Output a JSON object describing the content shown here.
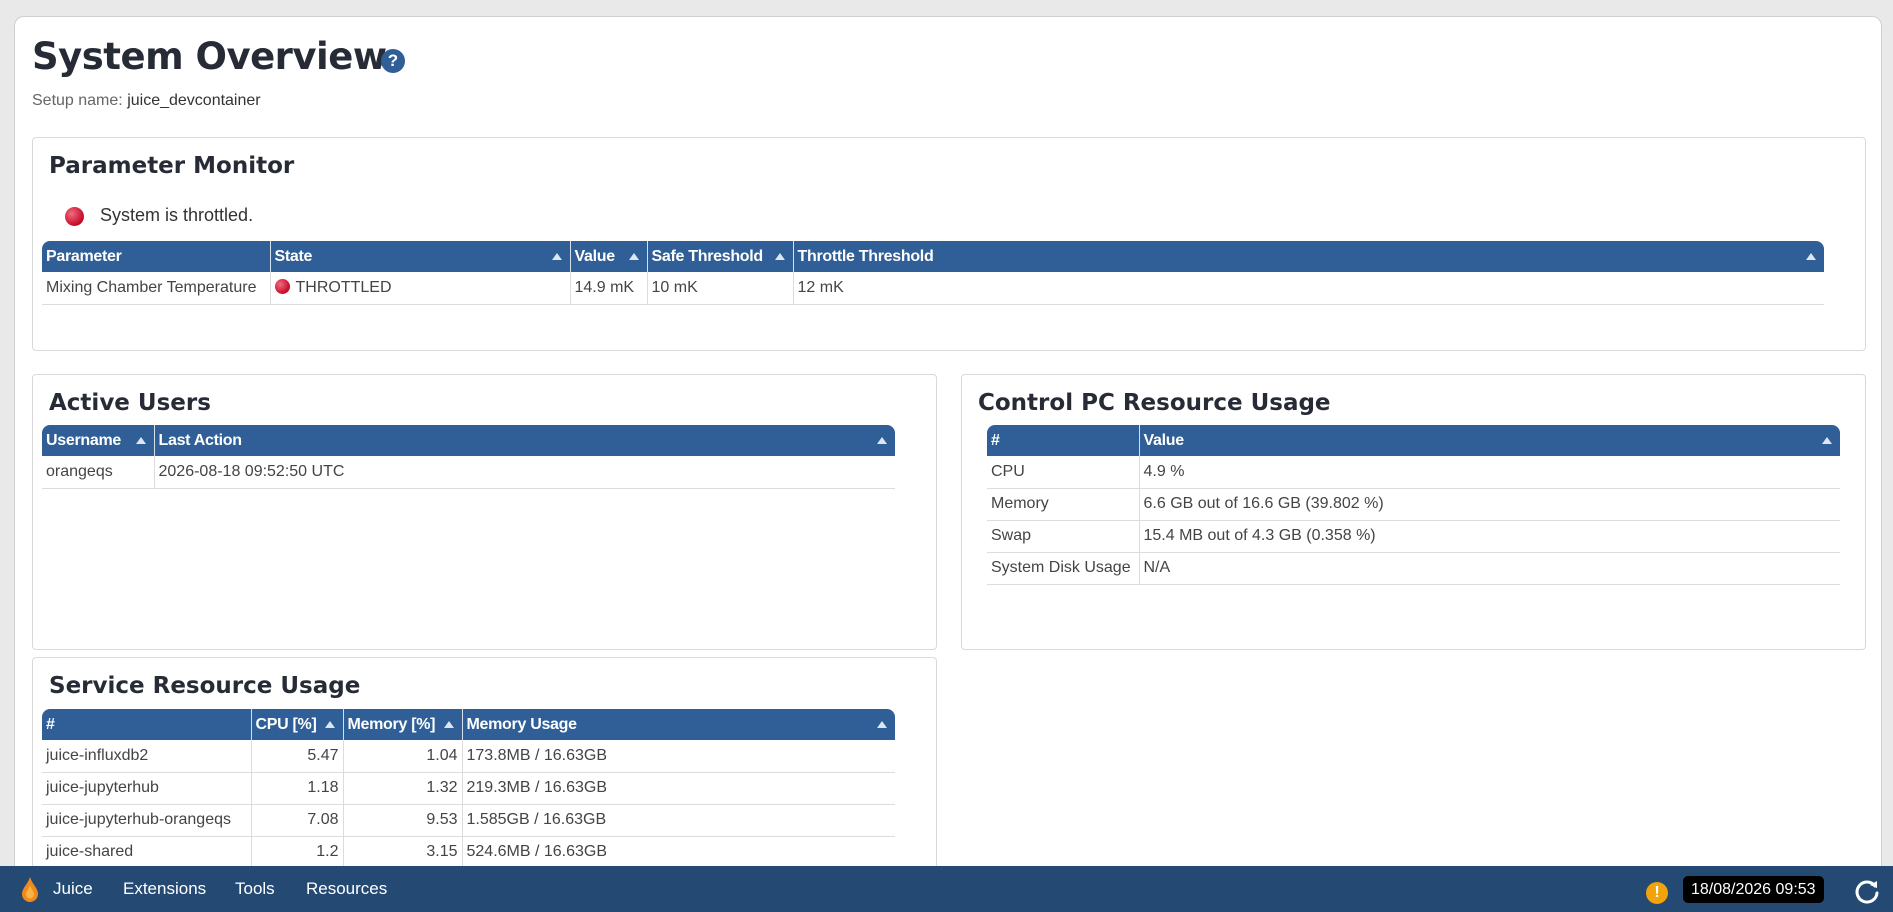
{
  "page": {
    "title": "System Overview",
    "help_icon": "?",
    "setup_label": "Setup name:",
    "setup_name": "juice_devcontainer"
  },
  "parameter_monitor": {
    "title": "Parameter Monitor",
    "status_text": "System is throttled.",
    "columns": [
      "Parameter",
      "State",
      "Value",
      "Safe Threshold",
      "Throttle Threshold"
    ],
    "rows": [
      [
        "Mixing Chamber Temperature",
        "THROTTLED",
        "14.9 mK",
        "10 mK",
        "12 mK"
      ]
    ]
  },
  "active_users": {
    "title": "Active Users",
    "columns": [
      "Username",
      "Last Action"
    ],
    "rows": [
      [
        "orangeqs",
        "2026-08-18 09:52:50 UTC"
      ]
    ]
  },
  "control_pc": {
    "title": "Control PC Resource Usage",
    "columns": [
      "#",
      "Value"
    ],
    "rows": [
      [
        "CPU",
        "4.9 %"
      ],
      [
        "Memory",
        "6.6 GB out of 16.6 GB (39.802 %)"
      ],
      [
        "Swap",
        "15.4 MB out of 4.3 GB (0.358 %)"
      ],
      [
        "System Disk Usage",
        "N/A"
      ]
    ]
  },
  "service_usage": {
    "title": "Service Resource Usage",
    "columns": [
      "#",
      "CPU [%]",
      "Memory [%]",
      "Memory Usage"
    ],
    "rows": [
      [
        "juice-influxdb2",
        "5.47",
        "1.04",
        "173.8MB / 16.63GB"
      ],
      [
        "juice-jupyterhub",
        "1.18",
        "1.32",
        "219.3MB / 16.63GB"
      ],
      [
        "juice-jupyterhub-orangeqs",
        "7.08",
        "9.53",
        "1.585GB / 16.63GB"
      ],
      [
        "juice-shared",
        "1.2",
        "3.15",
        "524.6MB / 16.63GB"
      ]
    ]
  },
  "taskbar": {
    "brand": "Juice",
    "menu": [
      "Extensions",
      "Tools",
      "Resources"
    ],
    "warning": "!",
    "clock": "18/08/2026 09:53"
  },
  "colors": {
    "header_blue": "#2f5f96",
    "taskbar_blue": "#244a74",
    "throttled_red": "#c8102e",
    "warning_orange": "#f0a30a"
  }
}
